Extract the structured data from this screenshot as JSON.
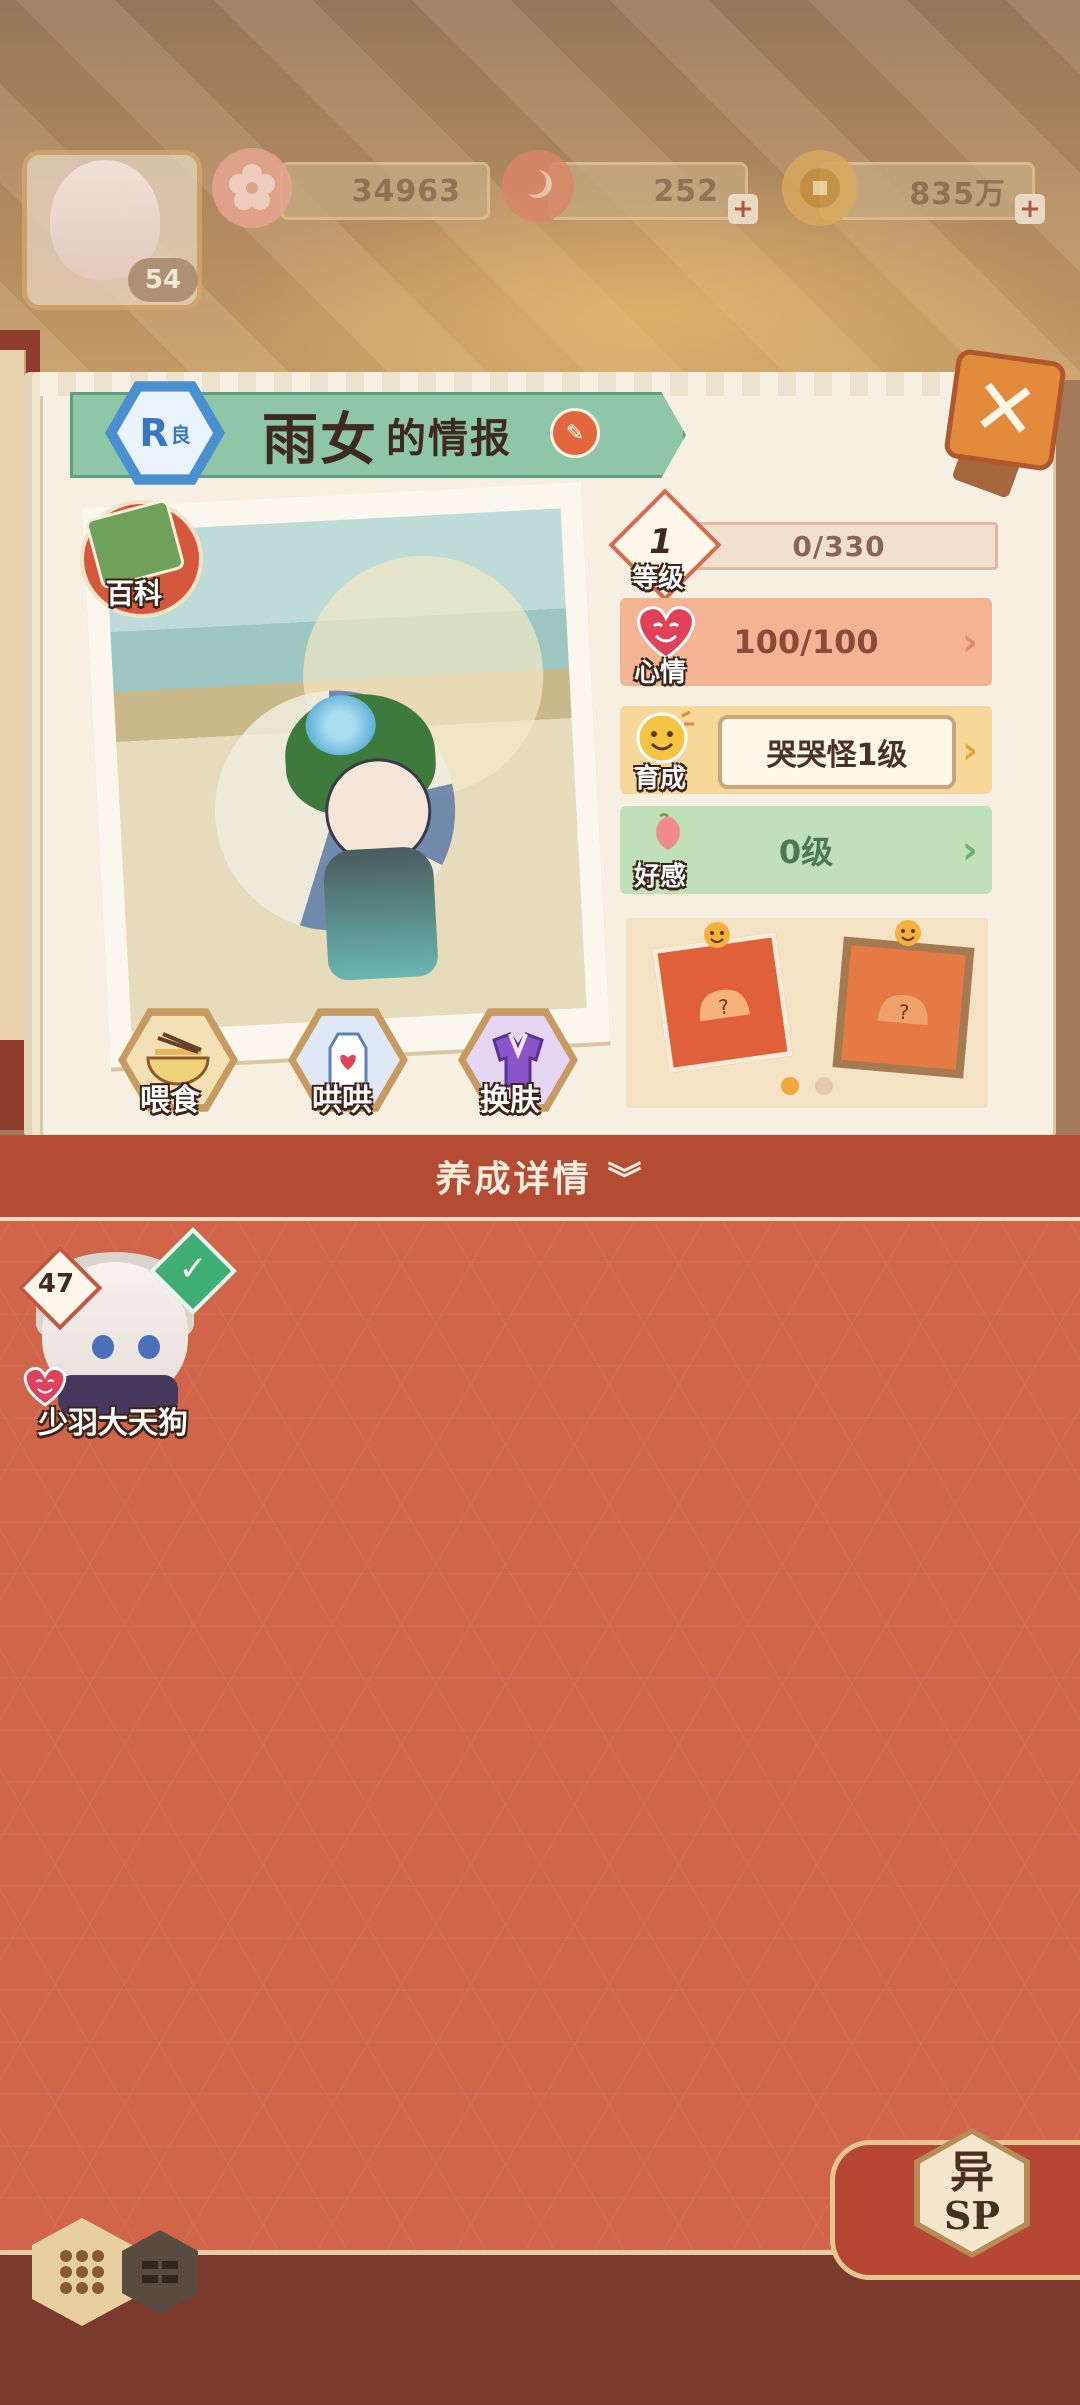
{
  "header": {
    "player_level": "54",
    "currencies": [
      {
        "name": "sakura-coupon",
        "value": "34963"
      },
      {
        "name": "magatama",
        "value": "252"
      },
      {
        "name": "coins",
        "value": "835万"
      }
    ]
  },
  "panel": {
    "rarity": "R",
    "rarity_sub": "良",
    "shikigami_name": "雨女",
    "title_suffix": "的情报",
    "encyclopedia_label": "百科",
    "actions": [
      {
        "label": "喂食",
        "icon": "noodle-bowl-icon"
      },
      {
        "label": "哄哄",
        "icon": "milk-carton-icon"
      },
      {
        "label": "换肤",
        "icon": "kimono-icon"
      }
    ]
  },
  "stats": {
    "level_number": "1",
    "level_label": "等级",
    "exp": "0/330",
    "mood_label": "心情",
    "mood_value": "100/100",
    "growth_label": "育成",
    "growth_value": "哭哭怪1级",
    "affection_label": "好感",
    "affection_value": "0级"
  },
  "unlock": {
    "page_count": 2,
    "active_page": 1
  },
  "details_label": "养成详情",
  "shikigami_list": [
    {
      "name": "少羽大天狗",
      "level": "47",
      "selected": true
    }
  ],
  "sp_badge": {
    "top": "异",
    "bottom": "SP"
  },
  "colors": {
    "accent_red": "#b44c35",
    "panel_bg": "#f6efe2",
    "mood": "#f4b494",
    "growth": "#f7d79a",
    "affection": "#bfe0b8"
  }
}
